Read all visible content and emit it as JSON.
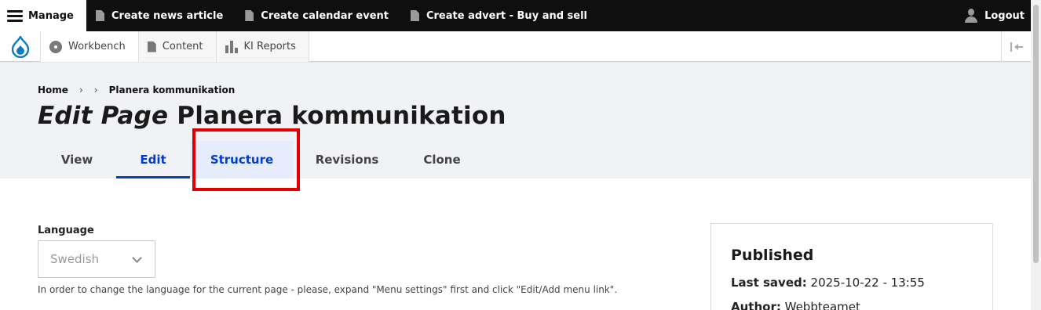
{
  "admin_bar": {
    "manage_label": "Manage",
    "items": [
      {
        "label": "Create news article",
        "icon": "document-icon"
      },
      {
        "label": "Create calendar event",
        "icon": "document-icon"
      },
      {
        "label": "Create advert - Buy and sell",
        "icon": "document-icon"
      }
    ],
    "logout_label": "Logout"
  },
  "toolbar": {
    "items": [
      {
        "label": "Workbench",
        "icon": "gear-icon"
      },
      {
        "label": "Content",
        "icon": "document-icon"
      },
      {
        "label": "KI Reports",
        "icon": "bar-chart-icon"
      }
    ]
  },
  "breadcrumb": {
    "home": "Home",
    "separator": "›",
    "current": "Planera kommunikation"
  },
  "page_title": {
    "prefix": "Edit Page",
    "name": "Planera kommunikation"
  },
  "tabs": [
    {
      "label": "View",
      "active": false
    },
    {
      "label": "Edit",
      "active": true
    },
    {
      "label": "Structure",
      "active": false,
      "highlighted": true
    },
    {
      "label": "Revisions",
      "active": false
    },
    {
      "label": "Clone",
      "active": false
    }
  ],
  "language": {
    "label": "Language",
    "value": "Swedish",
    "help": "In order to change the language for the current page - please, expand \"Menu settings\" first and click \"Edit/Add menu link\"."
  },
  "meta": {
    "status": "Published",
    "last_saved_label": "Last saved:",
    "last_saved_value": "2025-10-22 - 13:55",
    "author_label": "Author:",
    "author_value": "Webbteamet"
  },
  "colors": {
    "active_tab": "#003ecc",
    "highlight_border": "#e00000",
    "drupal_blue": "#0a7cc1"
  }
}
